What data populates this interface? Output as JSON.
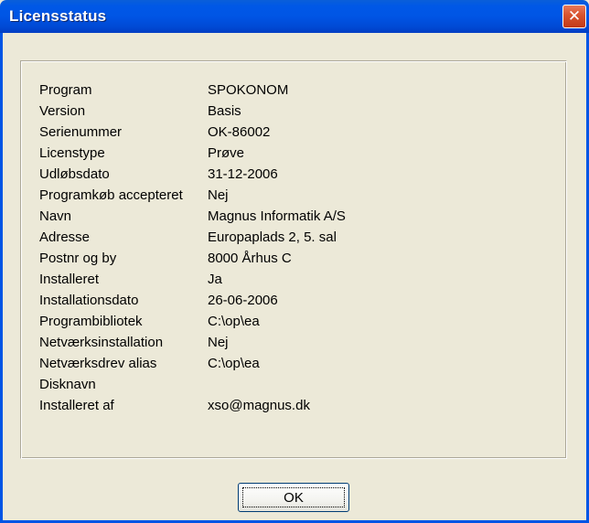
{
  "window": {
    "title": "Licensstatus",
    "close_glyph": "✕"
  },
  "license": {
    "rows": [
      {
        "label": "Program",
        "value": "SPOKONOM"
      },
      {
        "label": "Version",
        "value": "Basis"
      },
      {
        "label": "Serienummer",
        "value": "OK-86002"
      },
      {
        "label": "Licenstype",
        "value": "Prøve"
      },
      {
        "label": "Udløbsdato",
        "value": "31-12-2006"
      },
      {
        "label": "Programkøb accepteret",
        "value": "Nej"
      },
      {
        "label": "Navn",
        "value": "Magnus Informatik A/S"
      },
      {
        "label": "Adresse",
        "value": "Europaplads 2, 5. sal"
      },
      {
        "label": "Postnr og by",
        "value": "8000 Århus C"
      },
      {
        "label": "Installeret",
        "value": "Ja"
      },
      {
        "label": "Installationsdato",
        "value": "26-06-2006"
      },
      {
        "label": "Programbibliotek",
        "value": "C:\\op\\ea"
      },
      {
        "label": "Netværksinstallation",
        "value": "Nej"
      },
      {
        "label": "Netværksdrev alias",
        "value": "C:\\op\\ea"
      },
      {
        "label": "Disknavn",
        "value": ""
      },
      {
        "label": "Installeret af",
        "value": "xso@magnus.dk"
      }
    ]
  },
  "buttons": {
    "ok_label": "OK"
  },
  "colors": {
    "titlebar": "#0055e5",
    "dialog_bg": "#ece9d8",
    "close_button": "#d8522d"
  }
}
